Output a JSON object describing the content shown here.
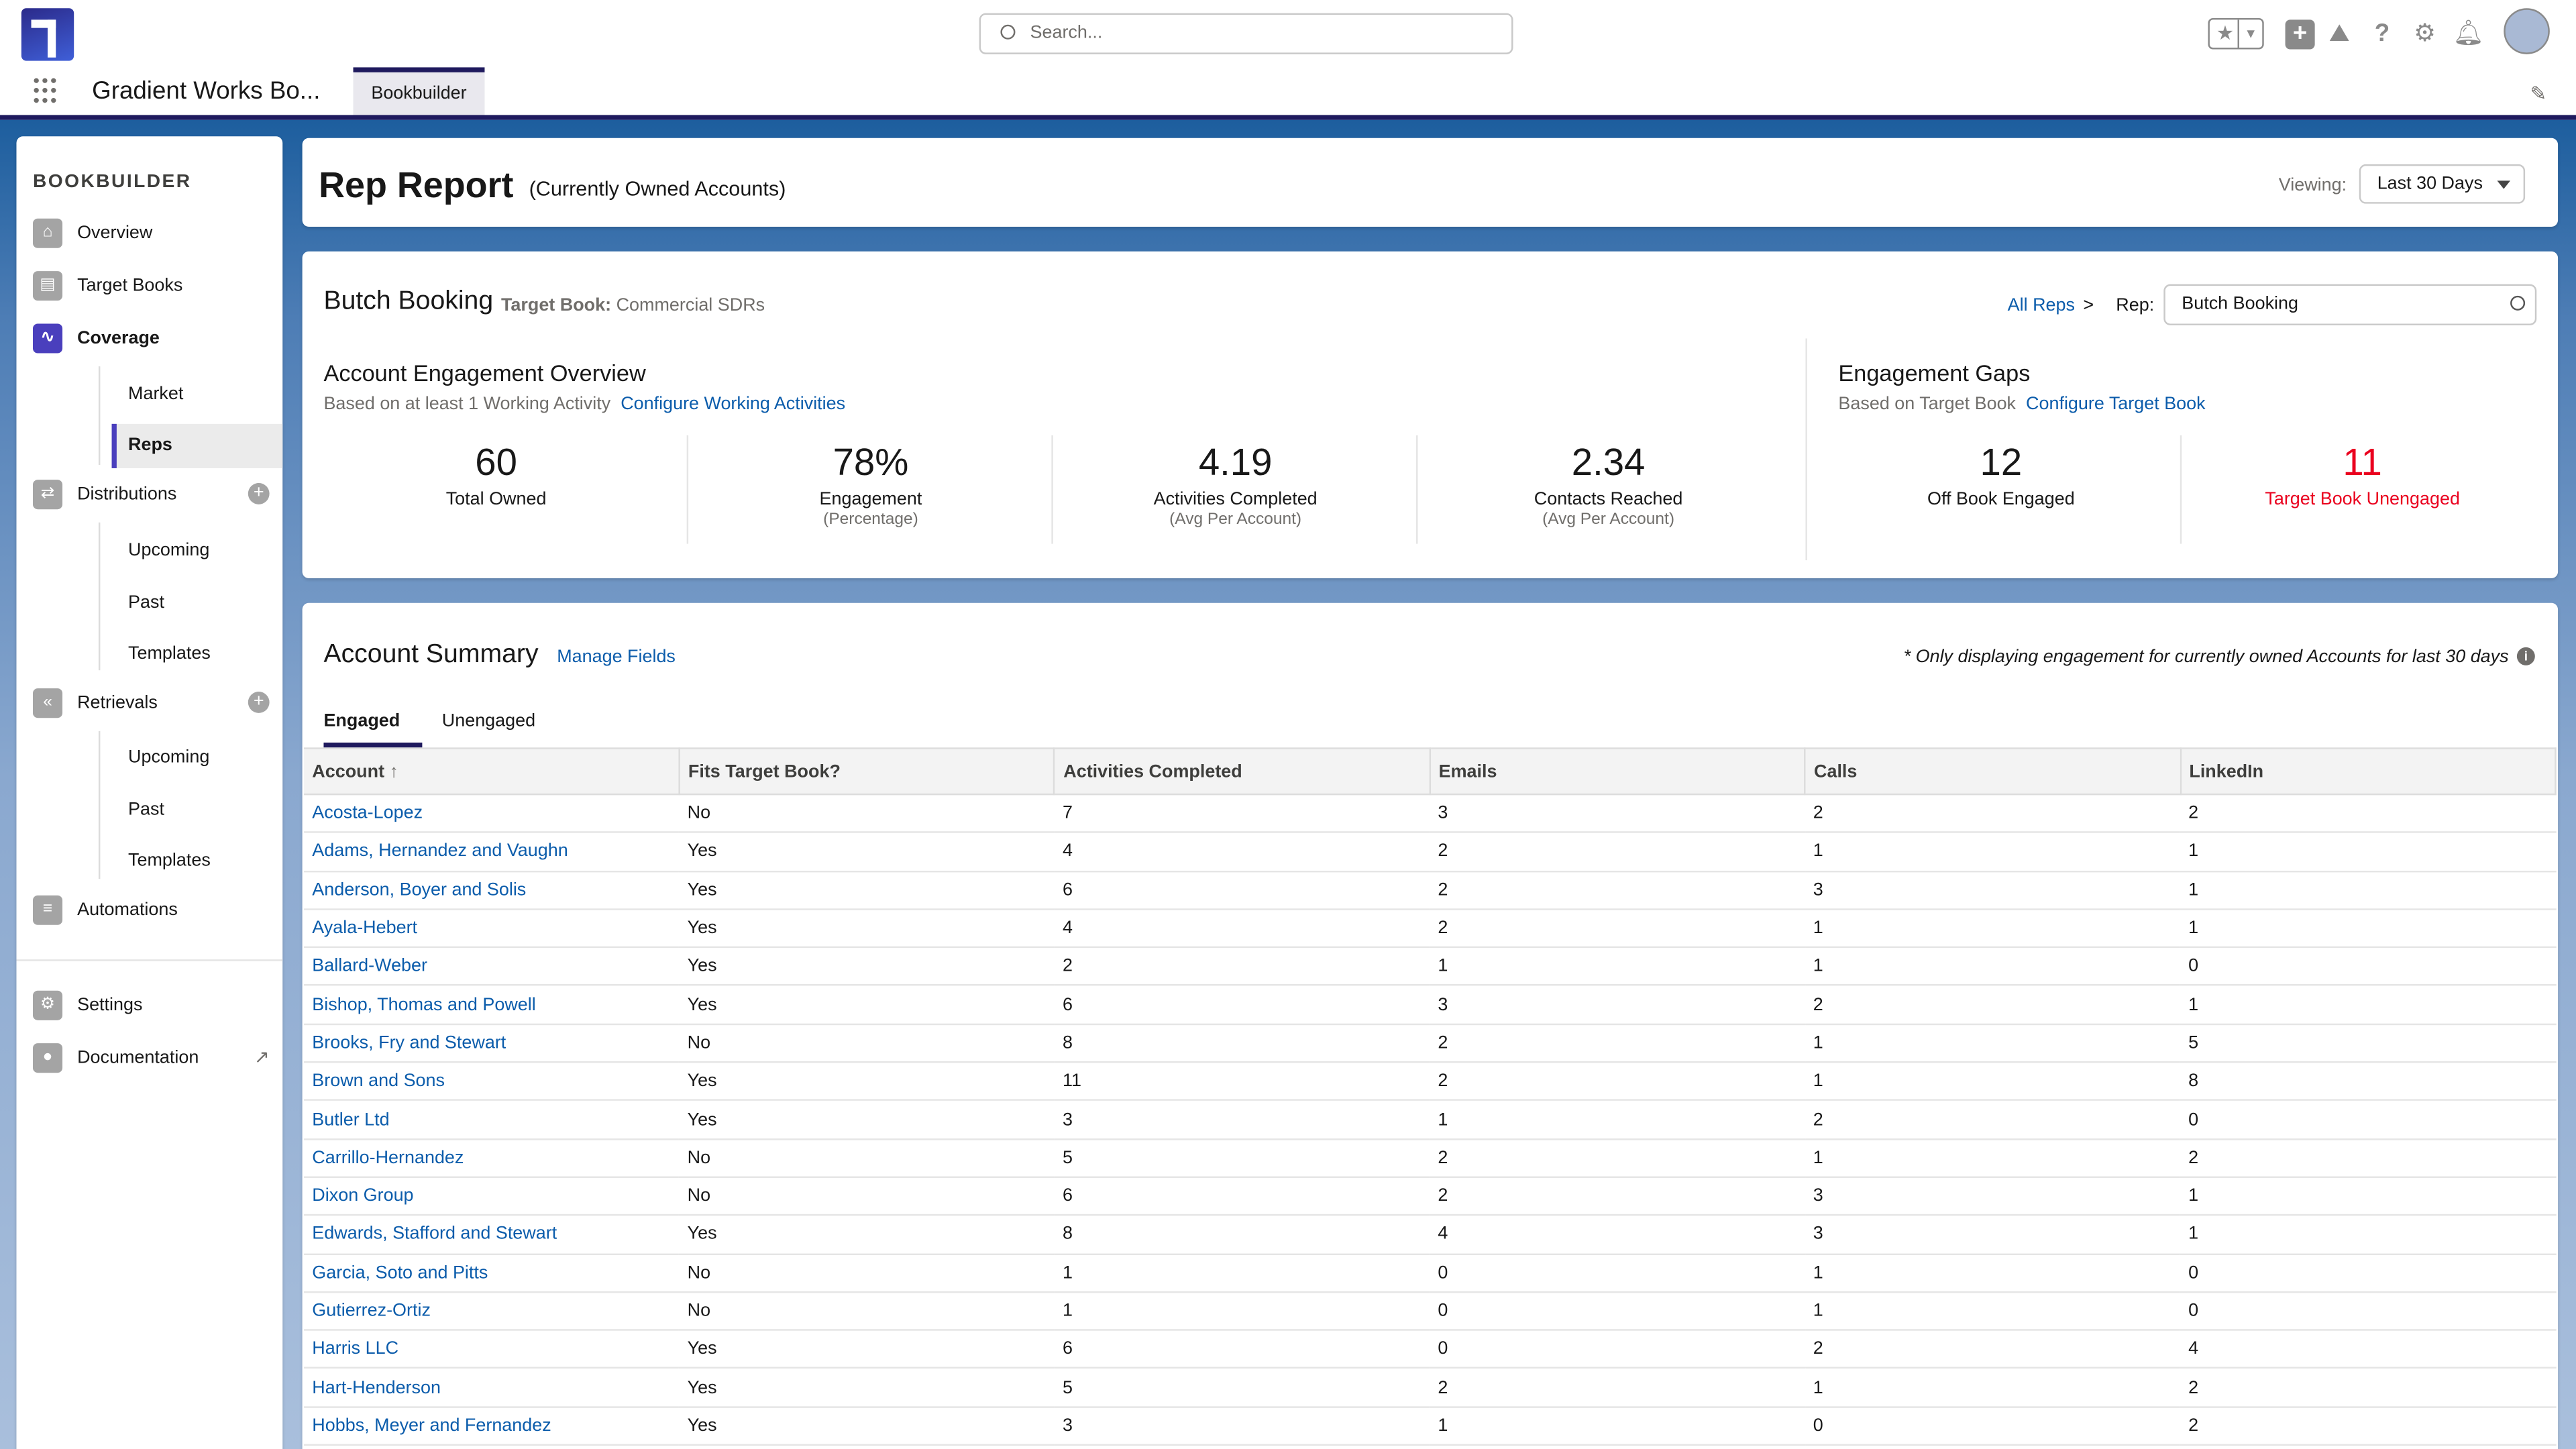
{
  "header": {
    "search_placeholder": "Search...",
    "app_name": "Gradient Works Bo...",
    "active_tab": "Bookbuilder",
    "icons": [
      "favorites-star-icon",
      "add-icon",
      "trailhead-icon",
      "help-icon",
      "setup-gear-icon",
      "bell-icon",
      "avatar"
    ]
  },
  "sidebar": {
    "title": "BOOKBUILDER",
    "overview": "Overview",
    "target_books": "Target Books",
    "coverage": "Coverage",
    "market": "Market",
    "reps": "Reps",
    "distributions": "Distributions",
    "dist_upcoming": "Upcoming",
    "dist_past": "Past",
    "dist_templates": "Templates",
    "retrievals": "Retrievals",
    "ret_upcoming": "Upcoming",
    "ret_past": "Past",
    "ret_templates": "Templates",
    "automations": "Automations",
    "settings": "Settings",
    "documentation": "Documentation"
  },
  "page": {
    "title": "Rep Report",
    "subtitle": "(Currently Owned Accounts)",
    "viewing_label": "Viewing:",
    "viewing_value": "Last 30 Days"
  },
  "rep": {
    "name": "Butch Booking",
    "target_book_label": "Target Book:",
    "target_book": "Commercial SDRs",
    "all_reps": "All Reps",
    "sep": ">",
    "rep_label": "Rep:",
    "rep_value": "Butch Booking"
  },
  "overview": {
    "title": "Account Engagement Overview",
    "desc": "Based on at least 1 Working Activity",
    "config_link": "Configure Working Activities",
    "metrics": [
      {
        "value": "60",
        "label": "Total Owned",
        "sub": ""
      },
      {
        "value": "78%",
        "label": "Engagement",
        "sub": "(Percentage)"
      },
      {
        "value": "4.19",
        "label": "Activities Completed",
        "sub": "(Avg Per Account)"
      },
      {
        "value": "2.34",
        "label": "Contacts Reached",
        "sub": "(Avg Per Account)"
      }
    ]
  },
  "gaps": {
    "title": "Engagement Gaps",
    "desc": "Based on Target Book",
    "config_link": "Configure Target Book",
    "metrics": [
      {
        "value": "12",
        "label": "Off Book Engaged"
      },
      {
        "value": "11",
        "label": "Target Book Unengaged"
      }
    ],
    "alert_color": "#ea001e"
  },
  "summary": {
    "title": "Account Summary",
    "manage_fields": "Manage Fields",
    "note": "* Only displaying engagement for currently owned Accounts for last 30 days",
    "tabs": [
      "Engaged",
      "Unengaged"
    ],
    "active_tab": "Engaged",
    "columns": [
      "Account",
      "Fits Target Book?",
      "Activities Completed",
      "Emails",
      "Calls",
      "LinkedIn"
    ],
    "sort_column": "Account",
    "sort_dir": "ascending",
    "rows": [
      [
        "Acosta-Lopez",
        "No",
        "7",
        "3",
        "2",
        "2"
      ],
      [
        "Adams, Hernandez and Vaughn",
        "Yes",
        "4",
        "2",
        "1",
        "1"
      ],
      [
        "Anderson, Boyer and Solis",
        "Yes",
        "6",
        "2",
        "3",
        "1"
      ],
      [
        "Ayala-Hebert",
        "Yes",
        "4",
        "2",
        "1",
        "1"
      ],
      [
        "Ballard-Weber",
        "Yes",
        "2",
        "1",
        "1",
        "0"
      ],
      [
        "Bishop, Thomas and Powell",
        "Yes",
        "6",
        "3",
        "2",
        "1"
      ],
      [
        "Brooks, Fry and Stewart",
        "No",
        "8",
        "2",
        "1",
        "5"
      ],
      [
        "Brown and Sons",
        "Yes",
        "11",
        "2",
        "1",
        "8"
      ],
      [
        "Butler Ltd",
        "Yes",
        "3",
        "1",
        "2",
        "0"
      ],
      [
        "Carrillo-Hernandez",
        "No",
        "5",
        "2",
        "1",
        "2"
      ],
      [
        "Dixon Group",
        "No",
        "6",
        "2",
        "3",
        "1"
      ],
      [
        "Edwards, Stafford and Stewart",
        "Yes",
        "8",
        "4",
        "3",
        "1"
      ],
      [
        "Garcia, Soto and Pitts",
        "No",
        "1",
        "0",
        "1",
        "0"
      ],
      [
        "Gutierrez-Ortiz",
        "No",
        "1",
        "0",
        "1",
        "0"
      ],
      [
        "Harris LLC",
        "Yes",
        "6",
        "0",
        "2",
        "4"
      ],
      [
        "Hart-Henderson",
        "Yes",
        "5",
        "2",
        "1",
        "2"
      ],
      [
        "Hobbs, Meyer and Fernandez",
        "Yes",
        "3",
        "1",
        "0",
        "2"
      ]
    ]
  }
}
